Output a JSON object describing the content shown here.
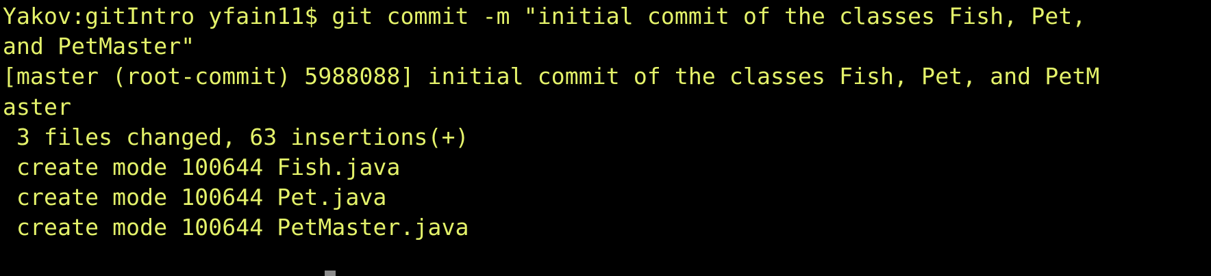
{
  "terminal": {
    "lines": [
      "Yakov:gitIntro yfain11$ git commit -m \"initial commit of the classes Fish, Pet,",
      "and PetMaster\"",
      "[master (root-commit) 5988088] initial commit of the classes Fish, Pet, and PetM",
      "aster",
      " 3 files changed, 63 insertions(+)",
      " create mode 100644 Fish.java",
      " create mode 100644 Pet.java",
      " create mode 100644 PetMaster.java"
    ],
    "text_color": "#e4f26a",
    "background_color": "#000000"
  }
}
